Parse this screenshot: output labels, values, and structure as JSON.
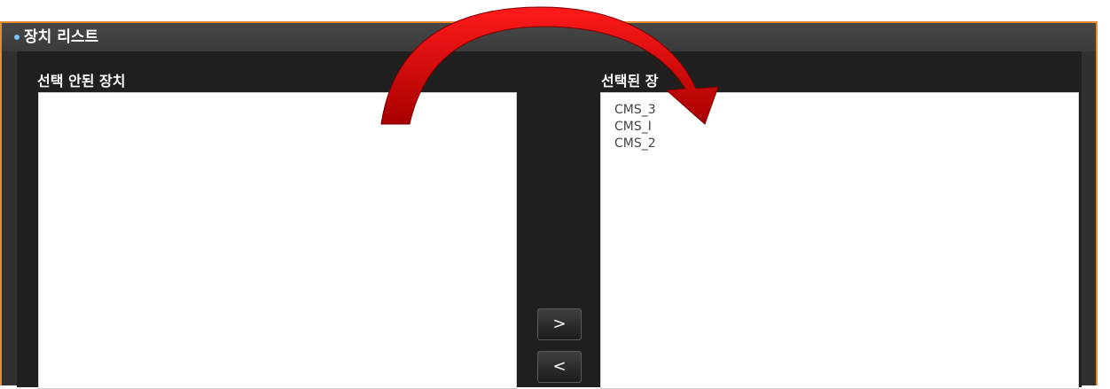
{
  "panel": {
    "title": "장치 리스트"
  },
  "unselected": {
    "label": "선택 안된 장치",
    "items": []
  },
  "selected": {
    "label": "선택된 장",
    "items": [
      "CMS_3",
      "CMS_I",
      "CMS_2"
    ]
  },
  "buttons": {
    "move_right": ">",
    "move_left": "<"
  },
  "colors": {
    "frame_border": "#e88b2a",
    "panel_bg": "#303030",
    "body_bg": "#1f1f1f",
    "bullet": "#7cc3ff",
    "arrow": "#d50000"
  },
  "icons": {
    "overlay": "curved-arrow-icon"
  }
}
